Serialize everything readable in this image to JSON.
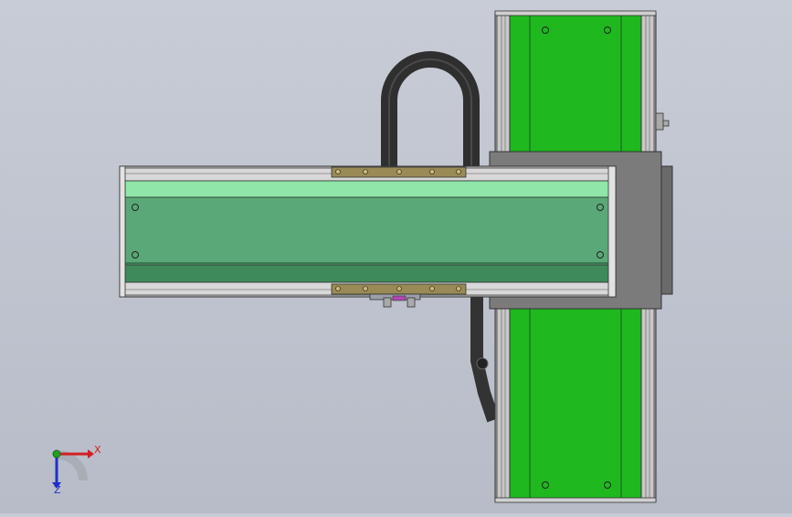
{
  "viewport": {
    "background": "#bfc3ce"
  },
  "colors": {
    "vertical_module_cover": "#1fb81f",
    "horizontal_module_cover_top": "#8fe6a8",
    "horizontal_module_cover": "#5aa877",
    "horizontal_module_cover_bottom": "#3e8a5a",
    "carriage_block": "#7b7b7b",
    "cable_chain": "#3a3a3a",
    "rail_frame": "#a9a9a9",
    "slider_block": "#9a8a55",
    "axis_x": "#d22020",
    "axis_y": "#20a020",
    "axis_z": "#2030c8"
  },
  "triad": {
    "x_label": "X",
    "z_label": "Z"
  }
}
